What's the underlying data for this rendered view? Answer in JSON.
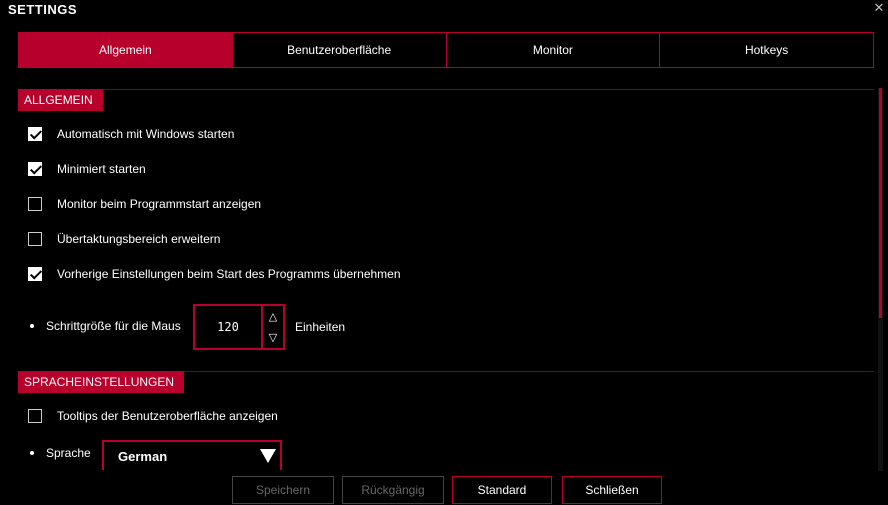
{
  "window": {
    "title": "SETTINGS",
    "close_glyph": "✕"
  },
  "tabs": [
    {
      "label": "Allgemein",
      "active": true
    },
    {
      "label": "Benutzeroberfläche",
      "active": false
    },
    {
      "label": "Monitor",
      "active": false
    },
    {
      "label": "Hotkeys",
      "active": false
    }
  ],
  "general": {
    "header": "ALLGEMEIN",
    "options": [
      {
        "label": "Automatisch mit Windows starten",
        "checked": true
      },
      {
        "label": "Minimiert starten",
        "checked": true
      },
      {
        "label": "Monitor beim Programmstart anzeigen",
        "checked": false
      },
      {
        "label": "Übertaktungsbereich erweitern",
        "checked": false
      },
      {
        "label": "Vorherige Einstellungen beim Start des Programms übernehmen",
        "checked": true
      }
    ],
    "mouse_step": {
      "label": "Schrittgröße für die Maus",
      "value": "120",
      "unit": "Einheiten",
      "up": "△",
      "down": "▽"
    }
  },
  "language": {
    "header": "SPRACHEINSTELLUNGEN",
    "tooltips": {
      "label": "Tooltips der Benutzeroberfläche anzeigen",
      "checked": false
    },
    "language_label": "Sprache",
    "language_value": "German"
  },
  "footer": {
    "save": "Speichern",
    "undo": "Rückgängig",
    "default": "Standard",
    "close": "Schließen"
  },
  "colors": {
    "accent": "#b8002c",
    "background": "#000000"
  }
}
